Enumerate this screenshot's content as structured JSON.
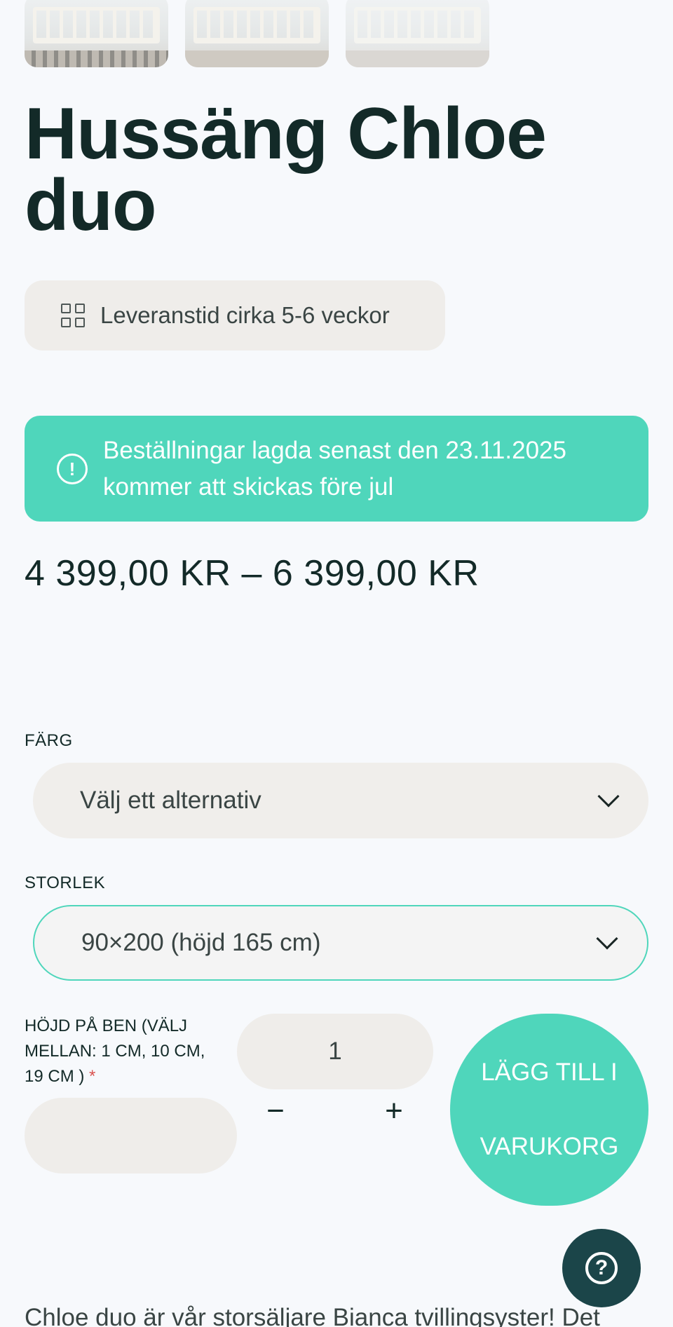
{
  "gallery": {
    "thumbnails": [
      {
        "icon": "bed-photo"
      },
      {
        "icon": "bed-photo"
      },
      {
        "icon": "bed-photo"
      }
    ]
  },
  "product": {
    "title": "Hussäng Chloe duo",
    "delivery": "Leveranstid cirka 5-6 veckor",
    "notice_line1": "Beställningar lagda senast den 23.11.2025",
    "notice_line2": "kommer att skickas före jul",
    "price": "4 399,00 KR – 6 399,00 KR"
  },
  "options": {
    "color_label": "FÄRG",
    "color_value": "Välj ett alternativ",
    "size_label": "STORLEK",
    "size_value": "90×200 (höjd 165 cm)",
    "height_label": "HÖJD PÅ BEN (VÄLJ MELLAN: 1 CM, 10 CM, 19 CM )",
    "height_required": "*",
    "height_value": ""
  },
  "cart": {
    "quantity": "1",
    "minus": "−",
    "plus": "+",
    "add_line1": "LÄGG TILL I",
    "add_line2": "VARUKORG"
  },
  "help": {
    "icon": "question-mark-icon",
    "glyph": "?"
  },
  "description": {
    "text": "Chloe duo är vår storsäljare Bianca tvillingsyster! Det"
  },
  "colors": {
    "accent": "#4fd6bb",
    "text": "#132a28",
    "field": "#efedea",
    "help_bg": "#1b4549"
  }
}
